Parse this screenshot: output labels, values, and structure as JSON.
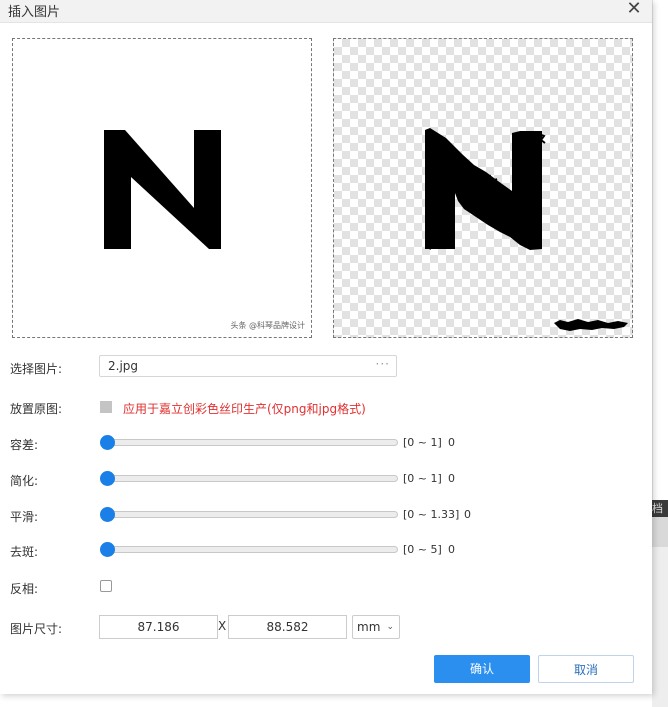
{
  "dialog": {
    "title": "插入图片",
    "close_glyph": "✕"
  },
  "preview": {
    "left_watermark": "头条 @科琴品牌设计",
    "right_watermark": ""
  },
  "file": {
    "label": "选择图片:",
    "value": "2.jpg",
    "more": "···"
  },
  "place_original": {
    "label": "放置原图:",
    "note": "应用于嘉立创彩色丝印生产(仅png和jpg格式)"
  },
  "sliders": [
    {
      "label": "容差:",
      "range": "[0 ~ 1]",
      "value": "0",
      "level": 0
    },
    {
      "label": "简化:",
      "range": "[0 ~ 1]",
      "value": "0",
      "level": 0
    },
    {
      "label": "平滑:",
      "range": "[0 ~ 1.33]",
      "value": "0",
      "level": 0
    },
    {
      "label": "去斑:",
      "range": "[0 ~ 5]",
      "value": "0",
      "level": 0
    }
  ],
  "invert": {
    "label": "反相:",
    "checked": false
  },
  "size": {
    "label": "图片尺寸:",
    "width": "87.186",
    "separator": "X",
    "height": "88.582",
    "unit": "mm",
    "unit_chevron": "⌄"
  },
  "buttons": {
    "ok": "确认",
    "cancel": "取消"
  },
  "background": {
    "partial_text": "档层"
  },
  "colors": {
    "accent": "#2a8fee",
    "slider_thumb": "#1a7fe6",
    "note_red": "#e03030"
  }
}
